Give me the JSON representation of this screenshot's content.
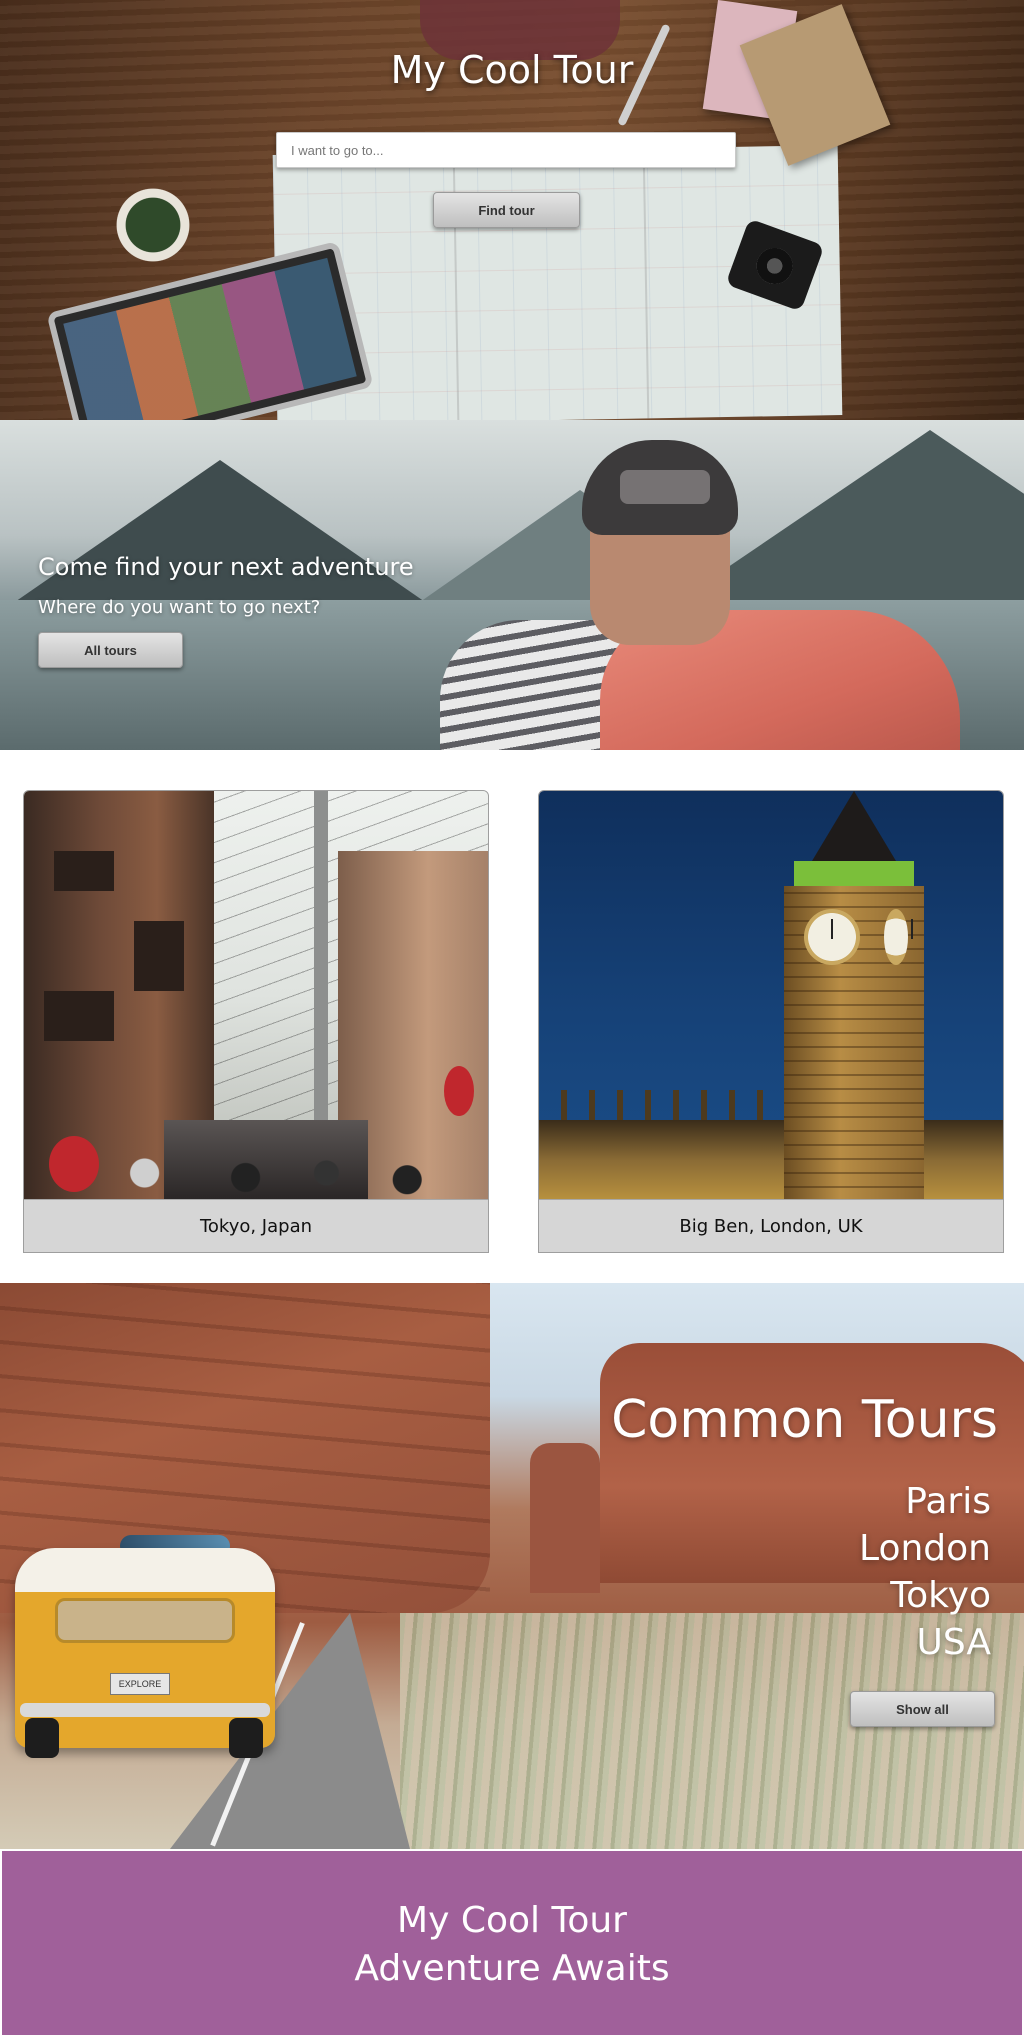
{
  "hero": {
    "title": "My Cool Tour",
    "search_placeholder": "I want to go to...",
    "search_value": "",
    "find_button_label": "Find tour"
  },
  "adventure": {
    "heading": "Come find your next adventure",
    "subheading": "Where do you want to go next?",
    "button_label": "All tours"
  },
  "cards": [
    {
      "caption": "Tokyo, Japan",
      "image": "tokyo-street-photo"
    },
    {
      "caption": "Big Ben, London, UK",
      "image": "big-ben-photo"
    }
  ],
  "common_tours": {
    "title": "Common Tours",
    "items": [
      "Paris",
      "London",
      "Tokyo",
      "USA"
    ],
    "button_label": "Show all",
    "van_plate": "EXPLORE"
  },
  "footer": {
    "line1": "My Cool Tour",
    "line2": "Adventure Awaits"
  },
  "colors": {
    "footer_background": "#a0609a",
    "card_caption_background": "#d6d6d6",
    "button_gradient_top": "#e4e4e4",
    "button_gradient_bottom": "#bfbfbf"
  }
}
